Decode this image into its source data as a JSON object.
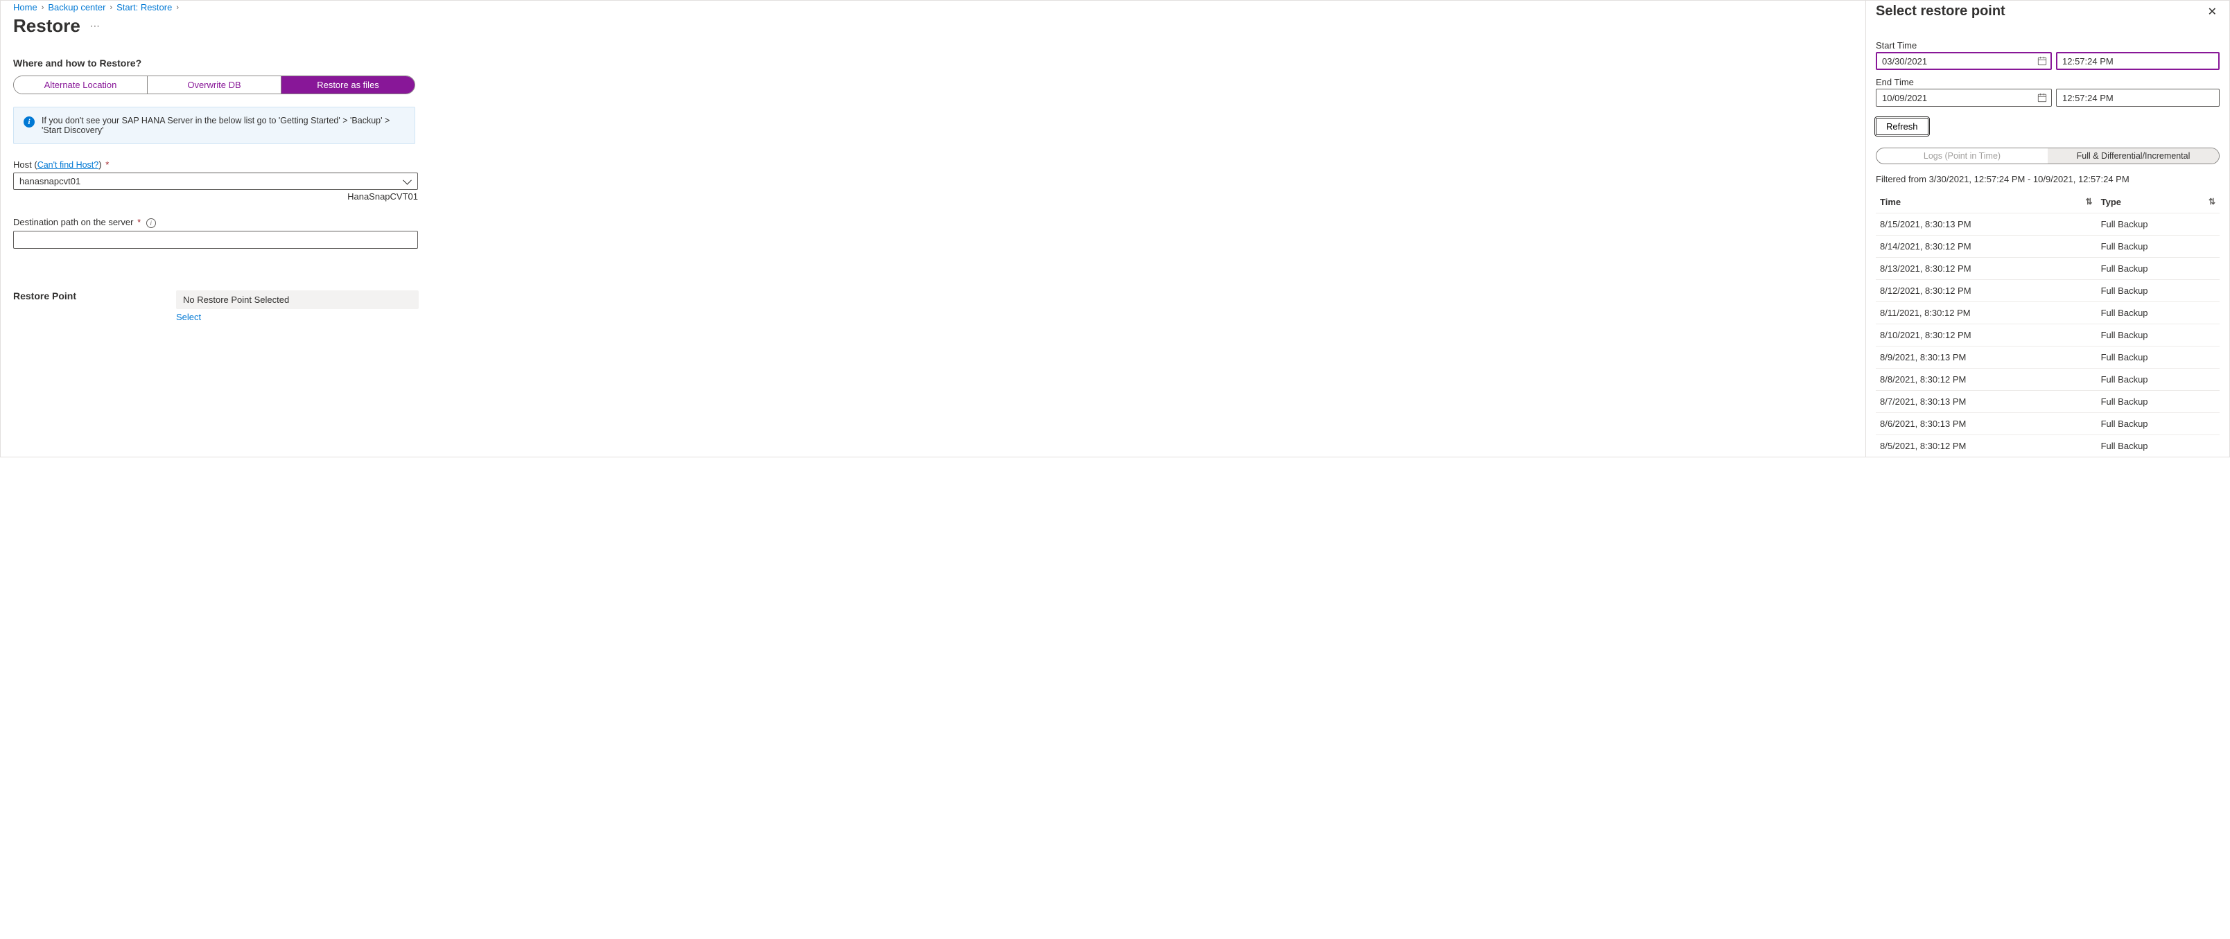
{
  "breadcrumb": {
    "home": "Home",
    "backup_center": "Backup center",
    "start_restore": "Start: Restore"
  },
  "page": {
    "title": "Restore",
    "section_heading": "Where and how to Restore?"
  },
  "pills": {
    "alt": "Alternate Location",
    "overwrite": "Overwrite DB",
    "files": "Restore as files"
  },
  "info": {
    "text": "If you don't see your SAP HANA Server in the below list go to 'Getting Started' > 'Backup' > 'Start Discovery'"
  },
  "host": {
    "label": "Host",
    "link": "Can't find Host?",
    "value": "hanasnapcvt01",
    "below": "HanaSnapCVT01"
  },
  "dest": {
    "label": "Destination path on the server",
    "value": ""
  },
  "restore_point": {
    "label": "Restore Point",
    "value": "No Restore Point Selected",
    "select": "Select"
  },
  "panel": {
    "title": "Select restore point",
    "start_label": "Start Time",
    "end_label": "End Time",
    "start_date": "03/30/2021",
    "start_time": "12:57:24 PM",
    "end_date": "10/09/2021",
    "end_time": "12:57:24 PM",
    "refresh": "Refresh",
    "toggle_logs": "Logs (Point in Time)",
    "toggle_full": "Full & Differential/Incremental",
    "filter_text": "Filtered from 3/30/2021, 12:57:24 PM - 10/9/2021, 12:57:24 PM",
    "col_time": "Time",
    "col_type": "Type",
    "rows": [
      {
        "time": "8/15/2021, 8:30:13 PM",
        "type": "Full Backup"
      },
      {
        "time": "8/14/2021, 8:30:12 PM",
        "type": "Full Backup"
      },
      {
        "time": "8/13/2021, 8:30:12 PM",
        "type": "Full Backup"
      },
      {
        "time": "8/12/2021, 8:30:12 PM",
        "type": "Full Backup"
      },
      {
        "time": "8/11/2021, 8:30:12 PM",
        "type": "Full Backup"
      },
      {
        "time": "8/10/2021, 8:30:12 PM",
        "type": "Full Backup"
      },
      {
        "time": "8/9/2021, 8:30:13 PM",
        "type": "Full Backup"
      },
      {
        "time": "8/8/2021, 8:30:12 PM",
        "type": "Full Backup"
      },
      {
        "time": "8/7/2021, 8:30:13 PM",
        "type": "Full Backup"
      },
      {
        "time": "8/6/2021, 8:30:13 PM",
        "type": "Full Backup"
      },
      {
        "time": "8/5/2021, 8:30:12 PM",
        "type": "Full Backup"
      }
    ]
  }
}
